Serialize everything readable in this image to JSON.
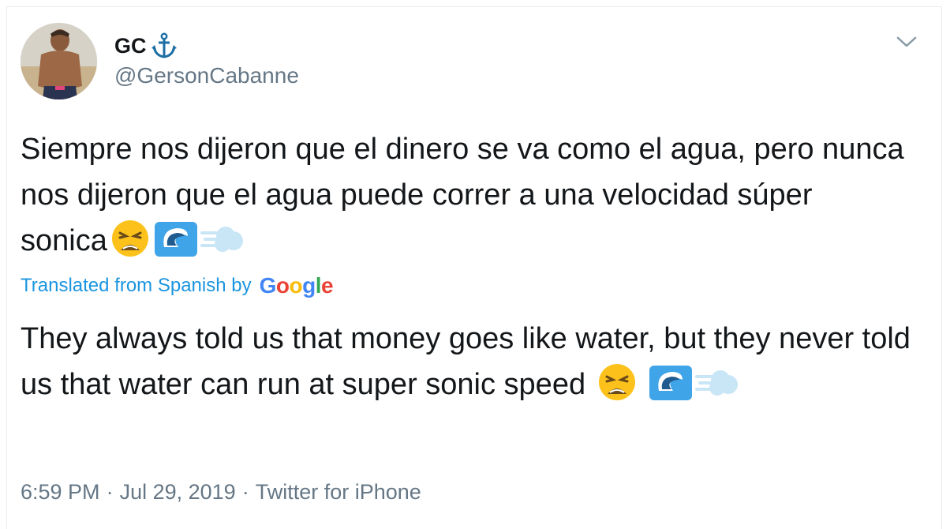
{
  "author": {
    "display_name": "GC",
    "handle": "@GersonCabanne",
    "badge_icon": "anchor-icon"
  },
  "tweet": {
    "text": "Siempre nos dijeron que el dinero se va como el agua, pero nunca nos dijeron que el agua puede correr a una velocidad súper sonica",
    "emojis": [
      "weary-face-emoji",
      "water-wave-emoji",
      "dash-symbol-emoji"
    ]
  },
  "translation": {
    "label": "Translated from Spanish by",
    "provider": "Google",
    "text": "They always told us that money goes like water, but they never told us that water can run at super sonic speed"
  },
  "meta": {
    "time": "6:59 PM",
    "separator": "·",
    "date": "Jul 29, 2019",
    "source": "Twitter for iPhone"
  },
  "colors": {
    "link": "#1b95e0",
    "secondary_text": "#657786",
    "primary_text": "#14171a"
  }
}
